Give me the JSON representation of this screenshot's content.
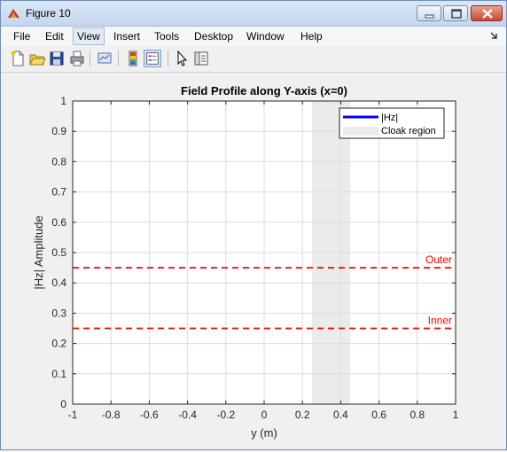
{
  "window": {
    "title": "Figure 10"
  },
  "menu": [
    "File",
    "Edit",
    "View",
    "Insert",
    "Tools",
    "Desktop",
    "Window",
    "Help"
  ],
  "active_menu": "View",
  "toolbar": [
    "new-figure",
    "open-file",
    "save",
    "print",
    "link-plot",
    "insert-colorbar",
    "insert-legend",
    "edit-plot",
    "property-inspector"
  ],
  "chart_data": {
    "type": "line",
    "title": "Field Profile along Y-axis (x=0)",
    "xlabel": "y (m)",
    "ylabel": "|Hz| Amplitude",
    "xlim": [
      -1,
      1
    ],
    "ylim": [
      0,
      1
    ],
    "xticks": [
      "-1",
      "-0.8",
      "-0.6",
      "-0.4",
      "-0.2",
      "0",
      "0.2",
      "0.4",
      "0.6",
      "0.8",
      "1"
    ],
    "yticks": [
      "0",
      "0.1",
      "0.2",
      "0.3",
      "0.4",
      "0.5",
      "0.6",
      "0.7",
      "0.8",
      "0.9",
      "1"
    ],
    "grid": true,
    "series": [
      {
        "name": "|Hz|",
        "color": "#0000ff",
        "values": []
      }
    ],
    "cloak_region": {
      "name": "Cloak region",
      "x_range": [
        0.25,
        0.45
      ],
      "color": "#ebebeb"
    },
    "reference_lines": [
      {
        "label": "Outer",
        "y": 0.45,
        "color": "#ff0000",
        "style": "dashed"
      },
      {
        "label": "Inner",
        "y": 0.25,
        "color": "#ff0000",
        "style": "dashed"
      }
    ],
    "legend_position": "top-right"
  }
}
